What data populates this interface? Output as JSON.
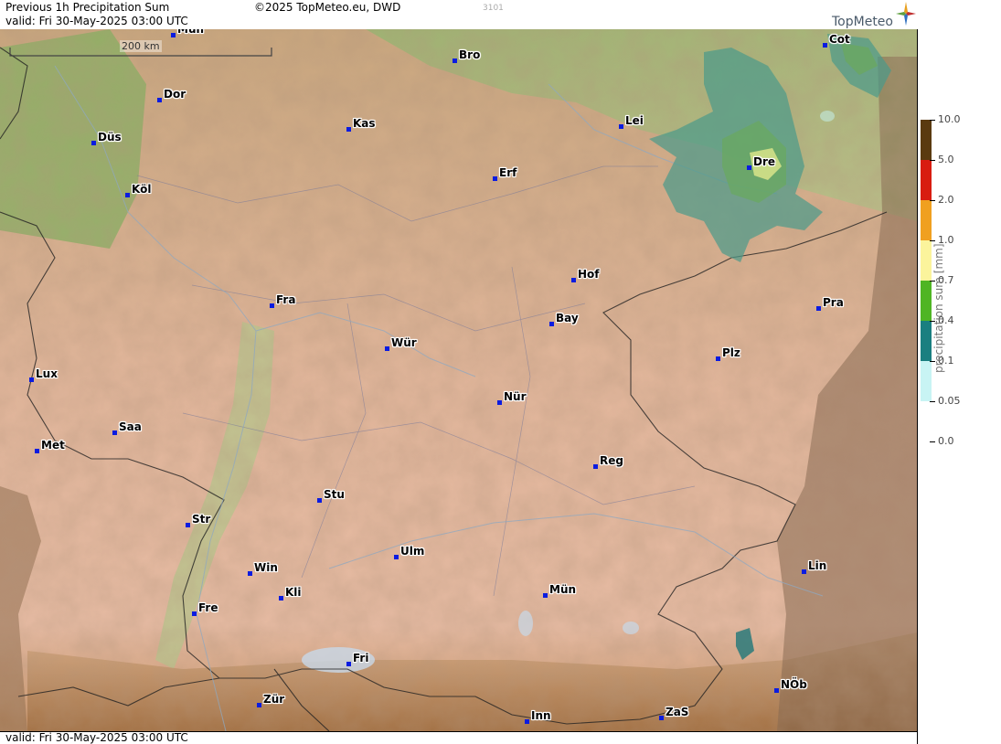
{
  "header": {
    "title": "Previous 1h Precipitation Sum",
    "valid": "valid:  Fri  30-May-2025 03:00 UTC",
    "copyright": "©2025 TopMeteo.eu, DWD",
    "code": "3101",
    "logo": "TopMeteo"
  },
  "footer": {
    "valid": "valid:  Fri  30-May-2025 03:00 UTC"
  },
  "scale": {
    "label": "200 km"
  },
  "legend": {
    "title": "precipitation sum [mm]",
    "levels": [
      {
        "label": "10.0",
        "color": "#5a3a10"
      },
      {
        "label": "5.0",
        "color": "#d81c10"
      },
      {
        "label": "2.0",
        "color": "#f0a020"
      },
      {
        "label": "1.0",
        "color": "#fbf49c"
      },
      {
        "label": "0.7",
        "color": "#4fb524"
      },
      {
        "label": "0.4",
        "color": "#1a7f80"
      },
      {
        "label": "0.1",
        "color": "#c8f4f4"
      },
      {
        "label": "0.05",
        "color": "#ffffff"
      },
      {
        "label": "0.0",
        "color": "#ffffff"
      }
    ]
  },
  "cities": [
    {
      "name": "Mün",
      "id": "munster"
    },
    {
      "name": "Bro",
      "id": "brocken"
    },
    {
      "name": "Cot",
      "id": "cottbus"
    },
    {
      "name": "Dor",
      "id": "dortmund"
    },
    {
      "name": "Kas",
      "id": "kassel"
    },
    {
      "name": "Lei",
      "id": "leipzig"
    },
    {
      "name": "Düs",
      "id": "dusseldorf"
    },
    {
      "name": "Erf",
      "id": "erfurt"
    },
    {
      "name": "Dre",
      "id": "dresden"
    },
    {
      "name": "Köl",
      "id": "koln"
    },
    {
      "name": "Hof",
      "id": "hof"
    },
    {
      "name": "Fra",
      "id": "frankfurt"
    },
    {
      "name": "Pra",
      "id": "prague"
    },
    {
      "name": "Bay",
      "id": "bayreuth"
    },
    {
      "name": "Wür",
      "id": "wurzburg"
    },
    {
      "name": "Plz",
      "id": "plzen"
    },
    {
      "name": "Lux",
      "id": "luxembourg"
    },
    {
      "name": "Nür",
      "id": "nurnberg"
    },
    {
      "name": "Saa",
      "id": "saarbrucken"
    },
    {
      "name": "Met",
      "id": "metz"
    },
    {
      "name": "Reg",
      "id": "regensburg"
    },
    {
      "name": "Stu",
      "id": "stuttgart"
    },
    {
      "name": "Str",
      "id": "strasbourg"
    },
    {
      "name": "Ulm",
      "id": "ulm"
    },
    {
      "name": "Lin",
      "id": "linz"
    },
    {
      "name": "Win",
      "id": "winterbach"
    },
    {
      "name": "Kli",
      "id": "klippeneck"
    },
    {
      "name": "Mün",
      "id": "munchen"
    },
    {
      "name": "Fre",
      "id": "freiburg"
    },
    {
      "name": "Fri",
      "id": "friedrichshafen"
    },
    {
      "name": "NÖb",
      "id": "noeb"
    },
    {
      "name": "Zür",
      "id": "zurich"
    },
    {
      "name": "Inn",
      "id": "innsbruck"
    },
    {
      "name": "ZaS",
      "id": "zas"
    }
  ]
}
